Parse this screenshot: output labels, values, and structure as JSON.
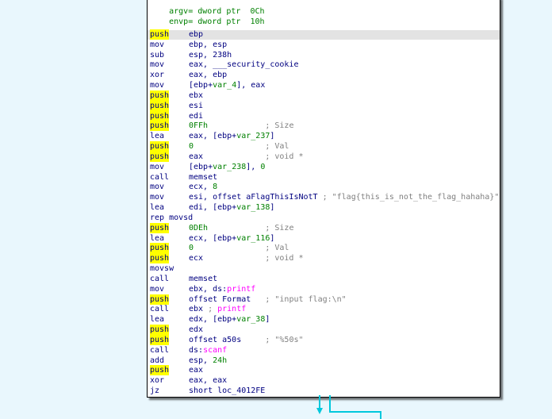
{
  "header": [
    {
      "name": "argv",
      "rest": "= dword ptr  0Ch"
    },
    {
      "name": "envp",
      "rest": "= dword ptr  10h"
    }
  ],
  "lines": [
    {
      "m": "push",
      "p": [
        {
          "t": "ebp"
        }
      ]
    },
    {
      "m": "mov",
      "p": [
        {
          "t": "ebp, esp"
        }
      ]
    },
    {
      "m": "sub",
      "p": [
        {
          "t": "esp, 238h"
        }
      ]
    },
    {
      "m": "mov",
      "p": [
        {
          "t": "eax, ___security_cookie"
        }
      ]
    },
    {
      "m": "xor",
      "p": [
        {
          "t": "eax, ebp"
        }
      ]
    },
    {
      "m": "mov",
      "p": [
        {
          "t": "[ebp+"
        },
        {
          "t": "var_4",
          "c": "v"
        },
        {
          "t": "], eax"
        }
      ]
    },
    {
      "m": "push",
      "p": [
        {
          "t": "ebx"
        }
      ]
    },
    {
      "m": "push",
      "p": [
        {
          "t": "esi"
        }
      ]
    },
    {
      "m": "push",
      "p": [
        {
          "t": "edi"
        }
      ]
    },
    {
      "m": "push",
      "p": [
        {
          "t": "0FFh",
          "c": "v"
        },
        {
          "t": "            ; Size",
          "c": "cm"
        }
      ]
    },
    {
      "m": "lea",
      "p": [
        {
          "t": "eax, [ebp+"
        },
        {
          "t": "var_237",
          "c": "v"
        },
        {
          "t": "]"
        }
      ]
    },
    {
      "m": "push",
      "p": [
        {
          "t": "0",
          "c": "v"
        },
        {
          "t": "               ; Val",
          "c": "cm"
        }
      ]
    },
    {
      "m": "push",
      "p": [
        {
          "t": "eax"
        },
        {
          "t": "             ; void *",
          "c": "cm"
        }
      ]
    },
    {
      "m": "mov",
      "p": [
        {
          "t": "[ebp+"
        },
        {
          "t": "var_238",
          "c": "v"
        },
        {
          "t": "], "
        },
        {
          "t": "0",
          "c": "v"
        }
      ]
    },
    {
      "m": "call",
      "p": [
        {
          "t": "memset"
        }
      ]
    },
    {
      "m": "mov",
      "p": [
        {
          "t": "ecx, "
        },
        {
          "t": "8",
          "c": "v"
        }
      ]
    },
    {
      "m": "mov",
      "p": [
        {
          "t": "esi, offset aFlagThisIsNotT"
        },
        {
          "t": " ; \"flag{this_is_not_the_flag_hahaha}\"",
          "c": "cm"
        }
      ]
    },
    {
      "m": "lea",
      "p": [
        {
          "t": "edi, [ebp+"
        },
        {
          "t": "var_138",
          "c": "v"
        },
        {
          "t": "]"
        }
      ]
    },
    {
      "m": "rep movsd",
      "p": []
    },
    {
      "m": "push",
      "p": [
        {
          "t": "0DEh",
          "c": "v"
        },
        {
          "t": "            ; Size",
          "c": "cm"
        }
      ]
    },
    {
      "m": "lea",
      "p": [
        {
          "t": "ecx, [ebp+"
        },
        {
          "t": "var_116",
          "c": "v"
        },
        {
          "t": "]"
        }
      ]
    },
    {
      "m": "push",
      "p": [
        {
          "t": "0",
          "c": "v"
        },
        {
          "t": "               ; Val",
          "c": "cm"
        }
      ]
    },
    {
      "m": "push",
      "p": [
        {
          "t": "ecx"
        },
        {
          "t": "             ; void *",
          "c": "cm"
        }
      ]
    },
    {
      "m": "movsw",
      "p": []
    },
    {
      "m": "call",
      "p": [
        {
          "t": "memset"
        }
      ]
    },
    {
      "m": "mov",
      "p": [
        {
          "t": "ebx, ds:"
        },
        {
          "t": "printf",
          "c": "fn"
        }
      ]
    },
    {
      "m": "push",
      "p": [
        {
          "t": "offset Format"
        },
        {
          "t": "   ; \"input flag:\\n\"",
          "c": "cm"
        }
      ]
    },
    {
      "m": "call",
      "p": [
        {
          "t": "ebx"
        },
        {
          "t": " ; ",
          "c": "cm"
        },
        {
          "t": "printf",
          "c": "fn"
        }
      ]
    },
    {
      "m": "lea",
      "p": [
        {
          "t": "edx, [ebp+"
        },
        {
          "t": "var_38",
          "c": "v"
        },
        {
          "t": "]"
        }
      ]
    },
    {
      "m": "push",
      "p": [
        {
          "t": "edx"
        }
      ]
    },
    {
      "m": "push",
      "p": [
        {
          "t": "offset a50s"
        },
        {
          "t": "     ; \"%50s\"",
          "c": "cm"
        }
      ]
    },
    {
      "m": "call",
      "p": [
        {
          "t": "ds:"
        },
        {
          "t": "scanf",
          "c": "fn"
        }
      ]
    },
    {
      "m": "add",
      "p": [
        {
          "t": "esp, "
        },
        {
          "t": "24h",
          "c": "v"
        }
      ]
    },
    {
      "m": "push",
      "p": [
        {
          "t": "eax"
        }
      ]
    },
    {
      "m": "xor",
      "p": [
        {
          "t": "eax, eax"
        }
      ]
    },
    {
      "m": "jz",
      "p": [
        {
          "t": "short loc_4012FE"
        }
      ]
    }
  ],
  "colors": {
    "background": "#e9f7fd",
    "push_highlight": "#ffff00",
    "connector": "#00c8dc"
  }
}
